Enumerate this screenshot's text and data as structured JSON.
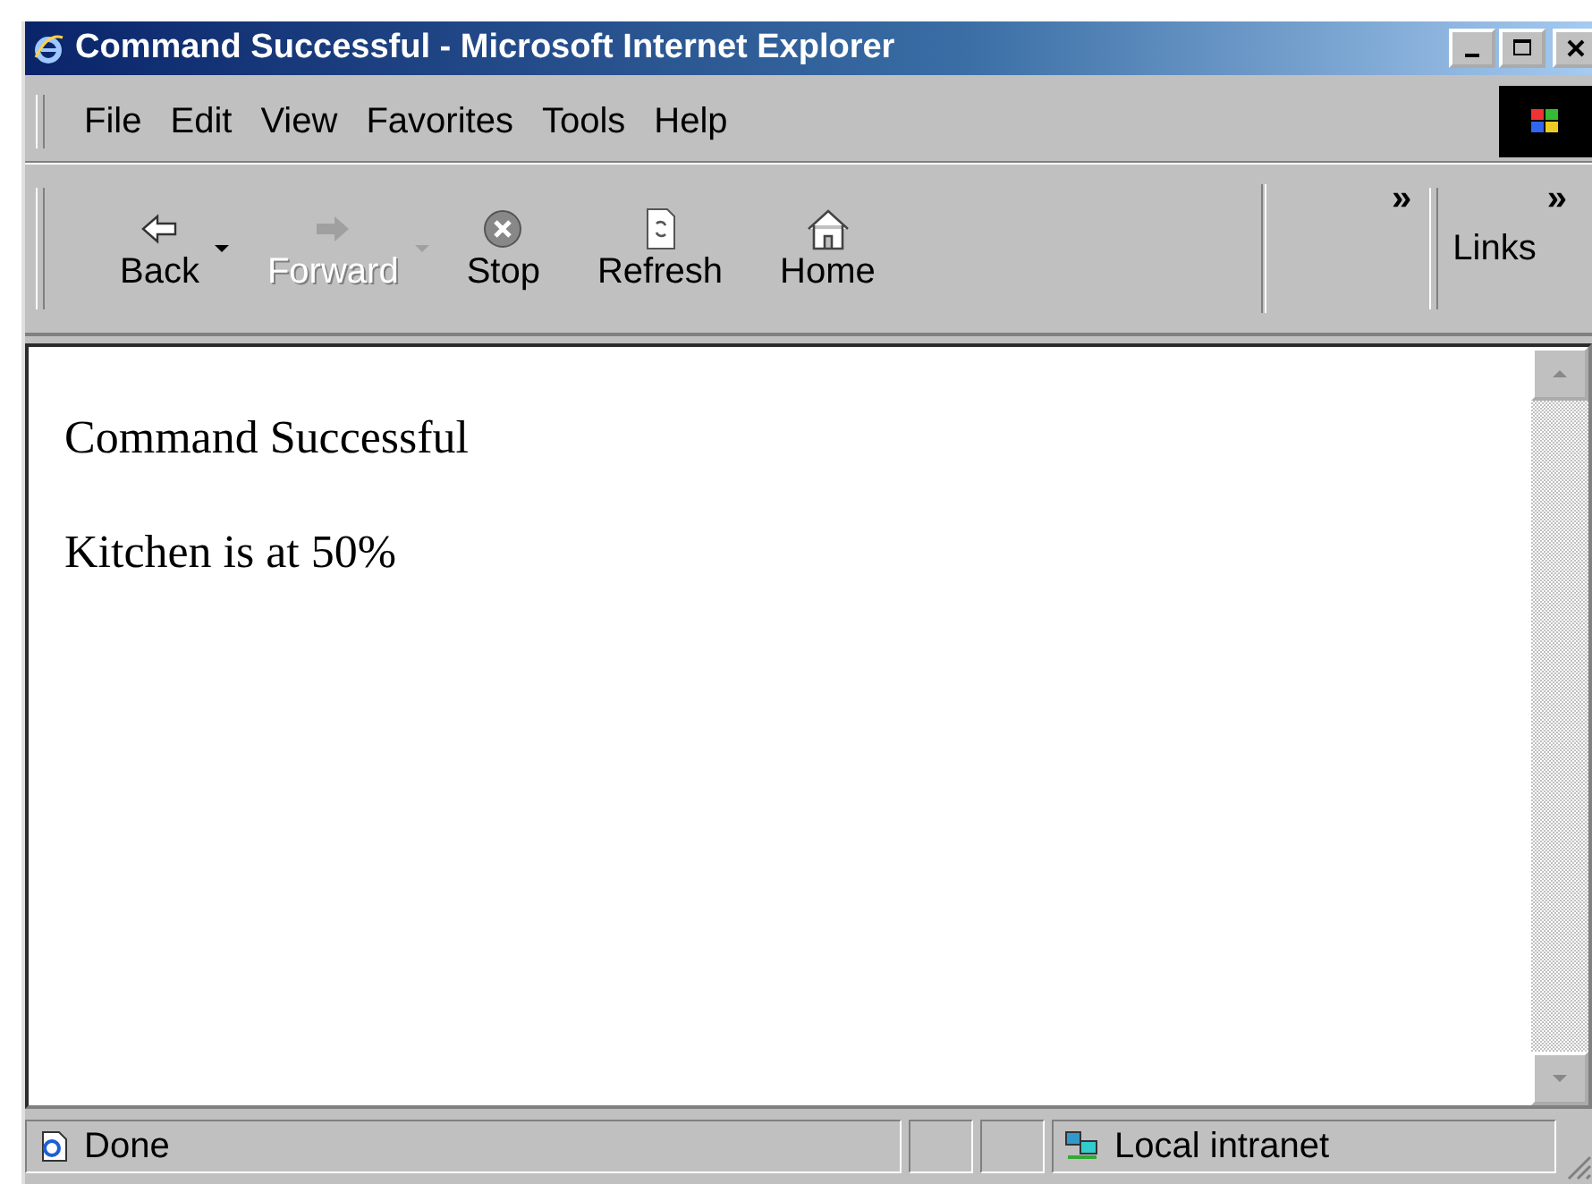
{
  "window": {
    "title": "Command Successful - Microsoft Internet Explorer"
  },
  "menu": [
    "File",
    "Edit",
    "View",
    "Favorites",
    "Tools",
    "Help"
  ],
  "toolbar": {
    "buttons": [
      {
        "label": "Back",
        "kind": "back",
        "disabled": false,
        "dropdown": true
      },
      {
        "label": "Forward",
        "kind": "forward",
        "disabled": true,
        "dropdown": true
      },
      {
        "label": "Stop",
        "kind": "stop",
        "disabled": false,
        "dropdown": false
      },
      {
        "label": "Refresh",
        "kind": "refresh",
        "disabled": false,
        "dropdown": false
      },
      {
        "label": "Home",
        "kind": "home",
        "disabled": false,
        "dropdown": false
      }
    ],
    "overflow": "»",
    "links_label": "Links",
    "links_overflow": "»"
  },
  "content": {
    "paragraphs": [
      "Command Successful",
      "Kitchen is at 50%"
    ]
  },
  "status_bar": {
    "text": "Done",
    "zone": "Local intranet"
  }
}
